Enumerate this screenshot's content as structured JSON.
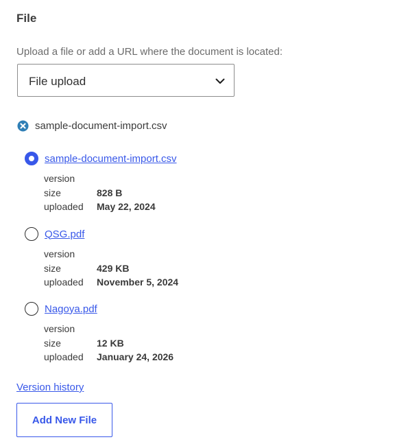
{
  "section": {
    "title": "File"
  },
  "upload": {
    "prompt": "Upload a file or add a URL where the document is located:",
    "select_value": "File upload",
    "select_icon": "chevron-down-icon"
  },
  "current_file": {
    "remove_icon": "remove-circle-icon",
    "name": "sample-document-import.csv"
  },
  "versions": [
    {
      "file_name": "sample-document-import.csv",
      "selected": true,
      "version_label": "version",
      "version_value": "",
      "size_label": "size",
      "size_value": "828 B",
      "uploaded_label": "uploaded",
      "uploaded_value": "May 22, 2024"
    },
    {
      "file_name": "QSG.pdf",
      "selected": false,
      "version_label": "version",
      "version_value": "",
      "size_label": "size",
      "size_value": "429 KB",
      "uploaded_label": "uploaded",
      "uploaded_value": "November 5, 2024"
    },
    {
      "file_name": "Nagoya.pdf",
      "selected": false,
      "version_label": "version",
      "version_value": "",
      "size_label": "size",
      "size_value": "12 KB",
      "uploaded_label": "uploaded",
      "uploaded_value": "January 24, 2026"
    }
  ],
  "links": {
    "version_history": "Version history"
  },
  "buttons": {
    "add_new_file": "Add New File"
  },
  "colors": {
    "accent": "#3858e9",
    "remove_icon": "#2f7fb6",
    "text": "#3a3a3a",
    "muted": "#6b6b6b"
  }
}
